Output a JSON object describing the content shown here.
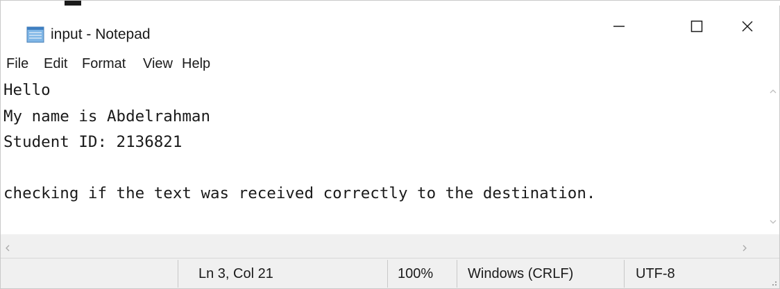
{
  "window": {
    "title": "input - Notepad"
  },
  "menu": {
    "items": [
      "File",
      "Edit",
      "Format",
      "View",
      "Help"
    ]
  },
  "editor": {
    "lines": [
      "Hello",
      "My name is Abdelrahman",
      "Student ID: 2136821",
      "",
      "checking if the text was received correctly to the destination."
    ]
  },
  "statusbar": {
    "position": "Ln 3, Col 21",
    "zoom": "100%",
    "line_ending": "Windows (CRLF)",
    "encoding": "UTF-8"
  },
  "icons": {
    "app": "notepad-icon",
    "minimize": "minimize-icon",
    "maximize": "maximize-icon",
    "close": "close-icon",
    "scroll_up": "chevron-up-icon",
    "scroll_down": "chevron-down-icon",
    "scroll_left": "chevron-left-icon",
    "scroll_right": "chevron-right-icon",
    "grip": "resize-grip-icon"
  },
  "colors": {
    "background": "#ffffff",
    "chrome": "#f0f0f0",
    "text": "#1a1a1a"
  }
}
